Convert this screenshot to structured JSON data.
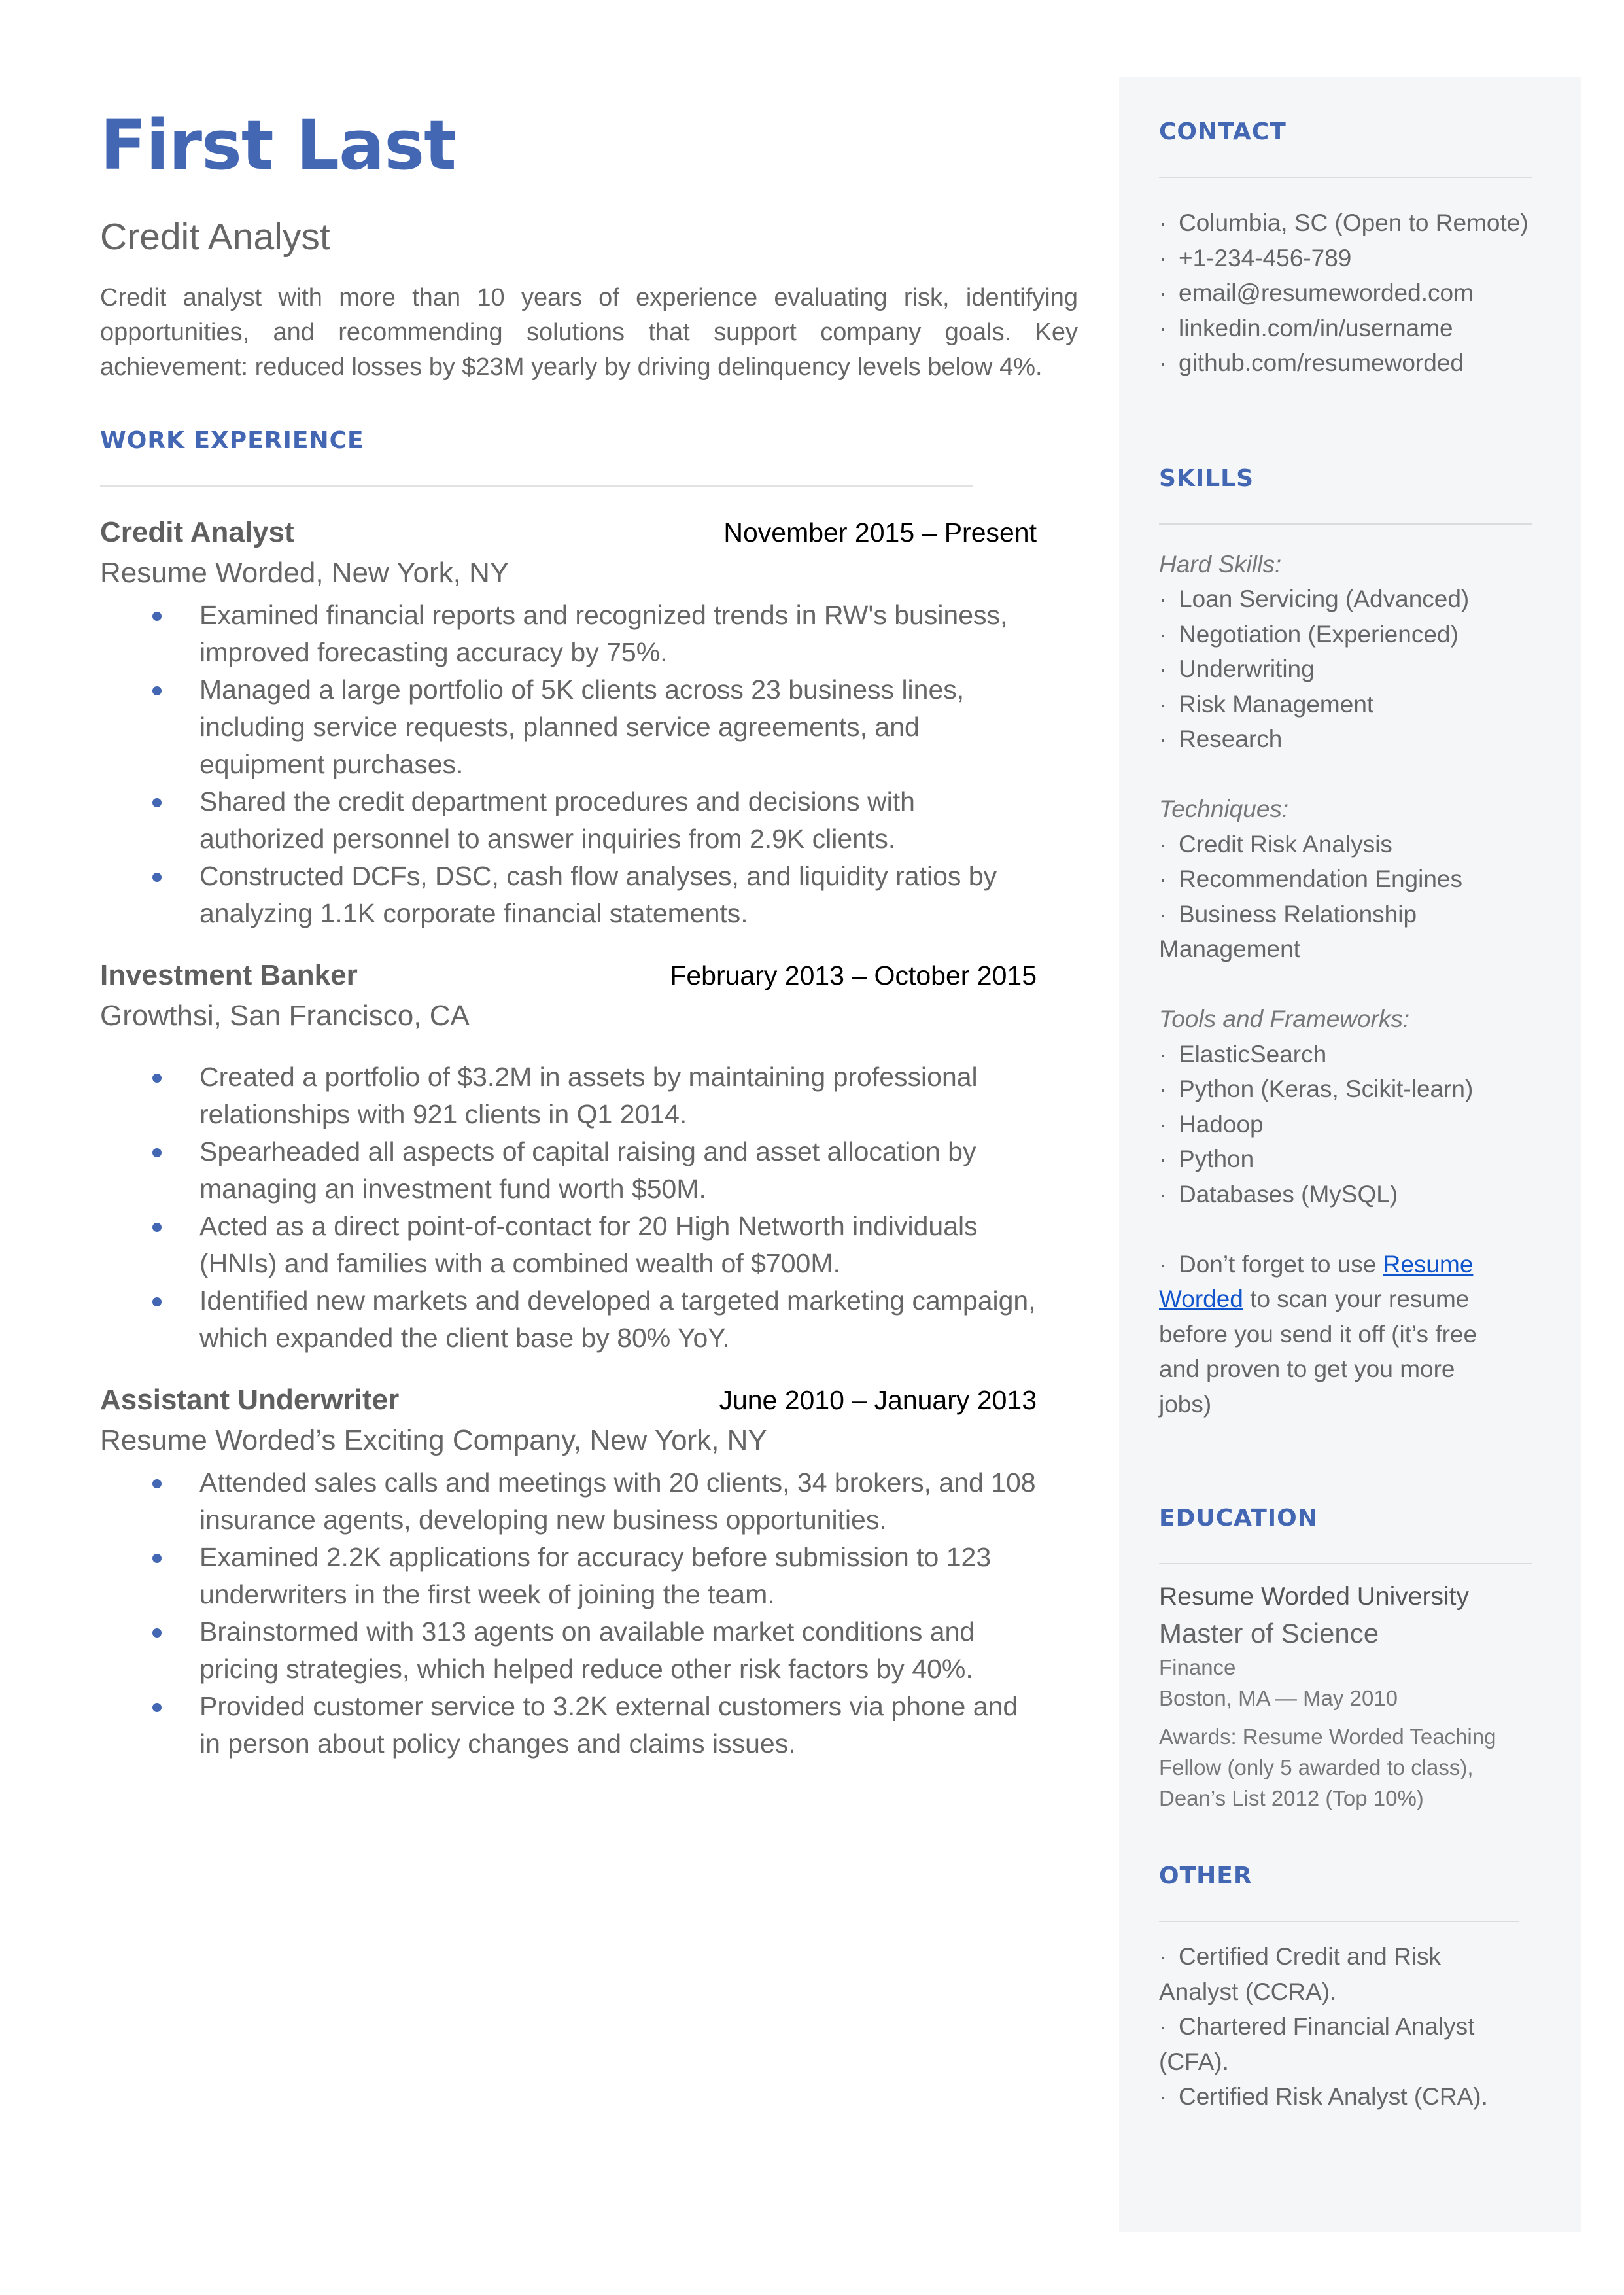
{
  "header": {
    "name": "First Last",
    "role": "Credit Analyst",
    "summary": "Credit analyst with more than 10 years of experience evaluating risk, identifying opportunities, and recommending solutions that support company goals. Key achievement: reduced losses by $23M yearly by driving delinquency levels below 4%."
  },
  "work": {
    "title": "WORK EXPERIENCE",
    "jobs": [
      {
        "title": "Credit Analyst",
        "dates": "November 2015 – Present",
        "company": "Resume Worded, New York, NY",
        "bullets": [
          "Examined financial reports and recognized trends in RW's business, improved forecasting accuracy by 75%.",
          "Managed a large portfolio of 5K clients across 23 business lines, including service requests, planned service agreements, and equipment purchases.",
          "Shared the credit department procedures and decisions with authorized personnel to answer inquiries from 2.9K clients.",
          "Constructed DCFs, DSC, cash flow analyses, and liquidity ratios by analyzing 1.1K corporate financial statements."
        ]
      },
      {
        "title": "Investment Banker",
        "dates": "February 2013 – October 2015",
        "company": "Growthsi, San Francisco, CA",
        "bullets": [
          "Created a portfolio of $3.2M in assets by maintaining professional relationships with 921 clients in Q1 2014.",
          "Spearheaded all aspects of capital raising and asset allocation by managing an investment fund worth $50M.",
          "Acted as a direct point-of-contact for 20 High Networth individuals (HNIs) and families with a combined wealth of $700M.",
          "Identified new markets and developed a targeted marketing campaign, which expanded the client base by 80% YoY."
        ]
      },
      {
        "title": "Assistant Underwriter",
        "dates": "June 2010 – January 2013",
        "company": "Resume Worded’s Exciting Company, New York, NY",
        "bullets": [
          "Attended sales calls and meetings with 20 clients, 34 brokers, and 108 insurance agents, developing new business opportunities.",
          "Examined 2.2K applications for accuracy before submission to 123 underwriters in the first week of joining the team.",
          "Brainstormed with 313 agents on available market conditions and pricing strategies, which helped reduce other risk factors by 40%.",
          "Provided customer service to 3.2K external customers via phone and in person about policy changes and claims issues."
        ]
      }
    ]
  },
  "sidebar": {
    "contact": {
      "title": "CONTACT",
      "items": [
        "Columbia, SC (Open to Remote)",
        "+1-234-456-789",
        "email@resumeworded.com",
        "linkedin.com/in/username",
        "github.com/resumeworded"
      ]
    },
    "skills": {
      "title": "SKILLS",
      "groups": [
        {
          "label": "Hard Skills:",
          "items": [
            "Loan Servicing (Advanced)",
            "Negotiation (Experienced)",
            "Underwriting",
            "Risk Management",
            "Research"
          ]
        },
        {
          "label": "Techniques:",
          "items": [
            "Credit Risk Analysis",
            "Recommendation Engines",
            "Business Relationship Management"
          ]
        },
        {
          "label": "Tools and Frameworks:",
          "items": [
            "ElasticSearch",
            "Python (Keras, Scikit-learn)",
            "Hadoop",
            "Python",
            "Databases (MySQL)"
          ]
        }
      ],
      "note": {
        "prefix": "Don’t forget to use ",
        "link": "Resume Worded",
        "suffix": " to scan your resume before you send it off (it’s free and proven to get you more jobs)"
      }
    },
    "education": {
      "title": "EDUCATION",
      "school": "Resume Worded University",
      "degree": "Master of Science",
      "field": "Finance",
      "location_date": "Boston, MA — May 2010",
      "awards": "Awards: Resume Worded Teaching Fellow (only 5 awarded to class), Dean’s List 2012 (Top 10%)"
    },
    "other": {
      "title": "OTHER",
      "items": [
        "Certified Credit and Risk Analyst (CCRA).",
        "Chartered Financial Analyst (CFA).",
        "Certified Risk Analyst (CRA)."
      ]
    }
  },
  "colors": {
    "accent": "#4467b3",
    "text": "#666666",
    "sidebar_bg": "#f5f6f8",
    "link": "#1155cc"
  }
}
